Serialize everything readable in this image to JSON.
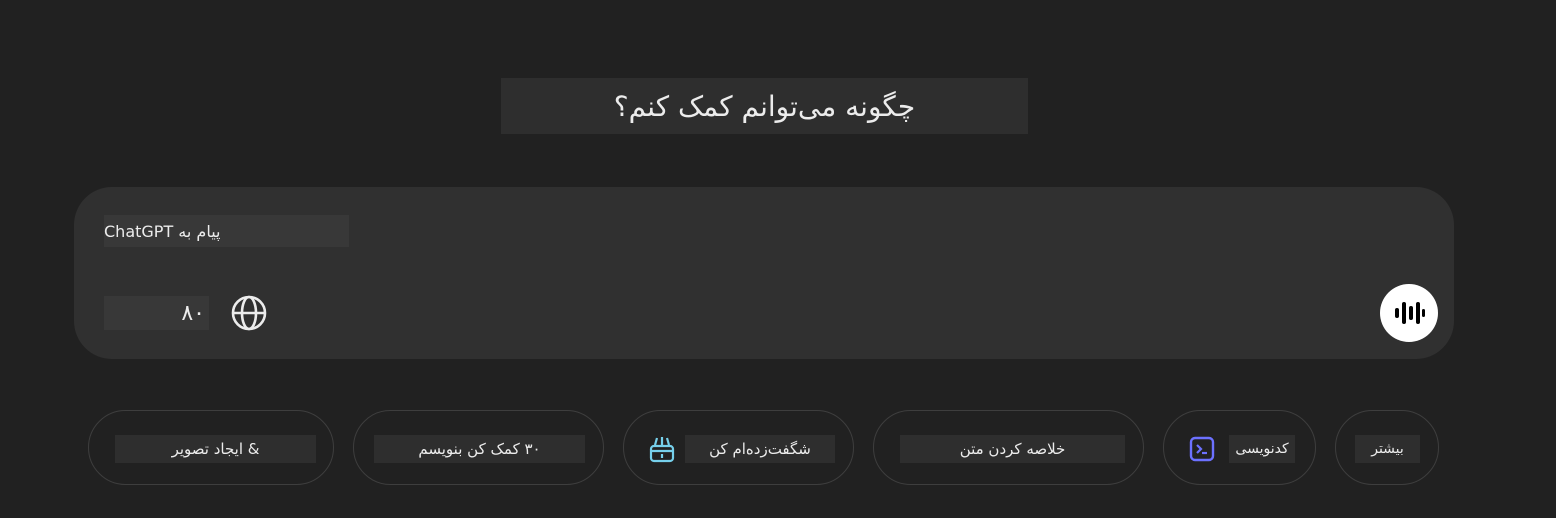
{
  "heading": "چگونه می‌توانم کمک کنم؟",
  "composer": {
    "placeholder": "پیام به ChatGPT",
    "attach_label": "۸۰",
    "globe_icon": "globe-icon",
    "voice_icon": "voice-waveform-icon"
  },
  "chips": [
    {
      "label": "& ایجاد تصویر",
      "icon": null
    },
    {
      "label": "۳۰ کمک کن بنویسم",
      "icon": null
    },
    {
      "label": "شگفت‌زده‌ام کن",
      "icon": "gift-icon",
      "icon_color": "#76d0eb"
    },
    {
      "label": "خلاصه کردن متن",
      "icon": null
    },
    {
      "label": "کدنویسی",
      "icon": "terminal-icon",
      "icon_color": "#6c71ff"
    },
    {
      "label": "بیشتر",
      "icon": null
    }
  ],
  "colors": {
    "background": "#212121",
    "composer": "#303030",
    "text": "#ececec"
  }
}
